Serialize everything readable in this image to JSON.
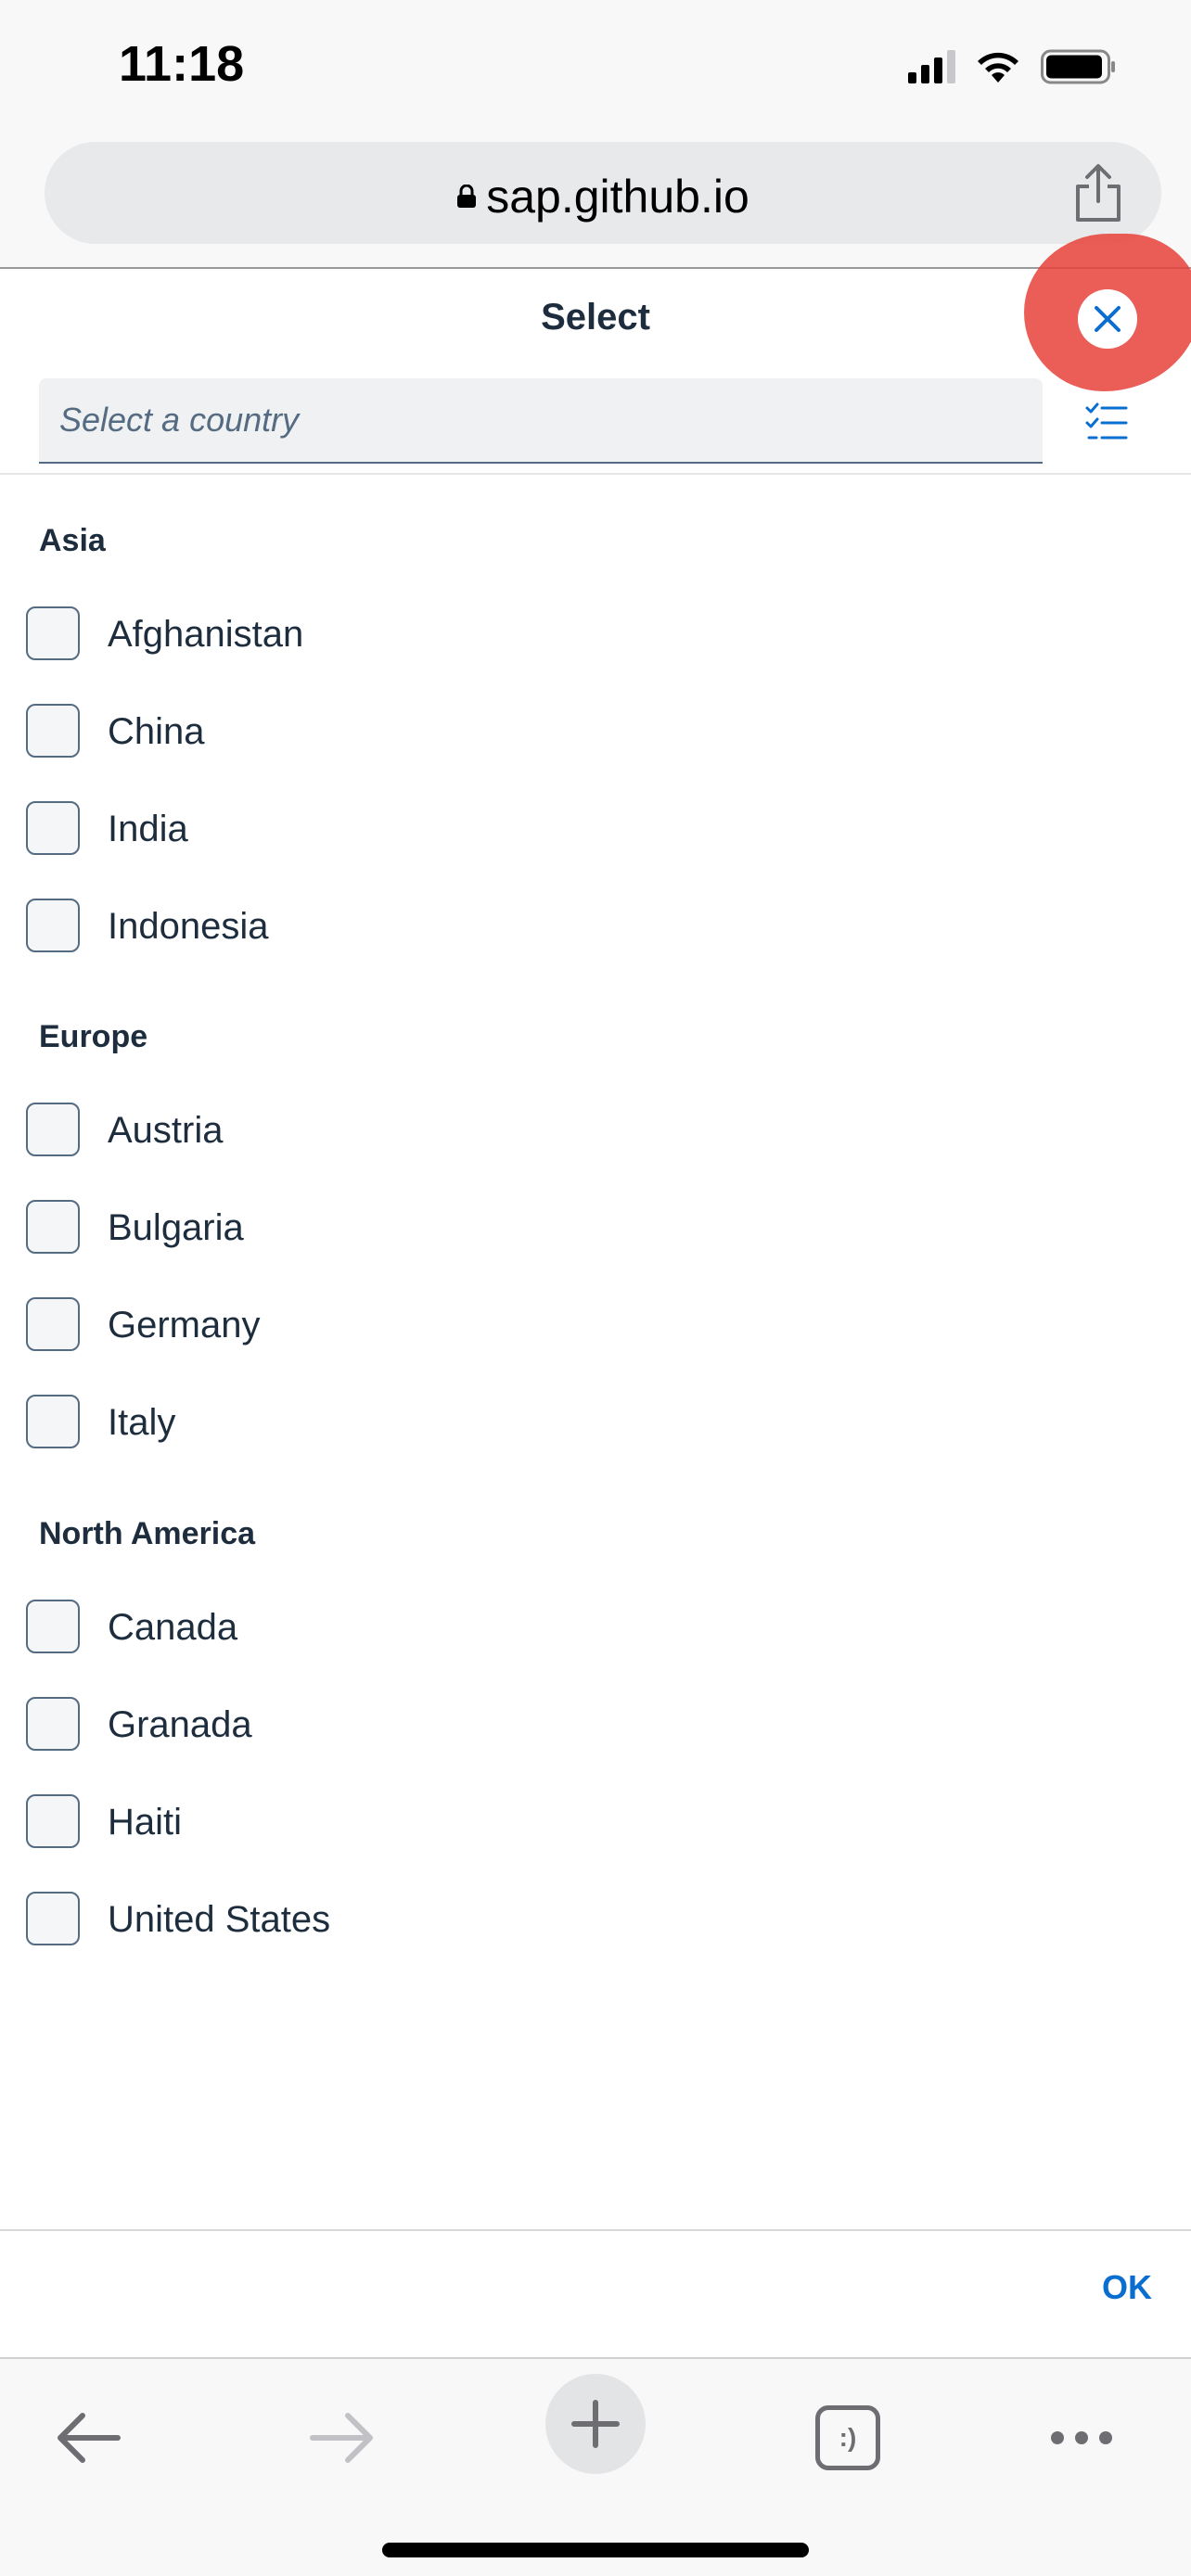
{
  "status_bar": {
    "time": "11:18"
  },
  "browser": {
    "url": "sap.github.io"
  },
  "dialog": {
    "title": "Select",
    "search_placeholder": "Select a country",
    "ok_label": "OK"
  },
  "groups": [
    {
      "name": "Asia",
      "items": [
        "Afghanistan",
        "China",
        "India",
        "Indonesia"
      ]
    },
    {
      "name": "Europe",
      "items": [
        "Austria",
        "Bulgaria",
        "Germany",
        "Italy"
      ]
    },
    {
      "name": "North America",
      "items": [
        "Canada",
        "Granada",
        "Haiti",
        "United States"
      ]
    }
  ],
  "tabs_button_label": ":)",
  "colors": {
    "accent": "#0a6ed1",
    "annotation": "#e8413a",
    "text": "#1d2d3e"
  }
}
